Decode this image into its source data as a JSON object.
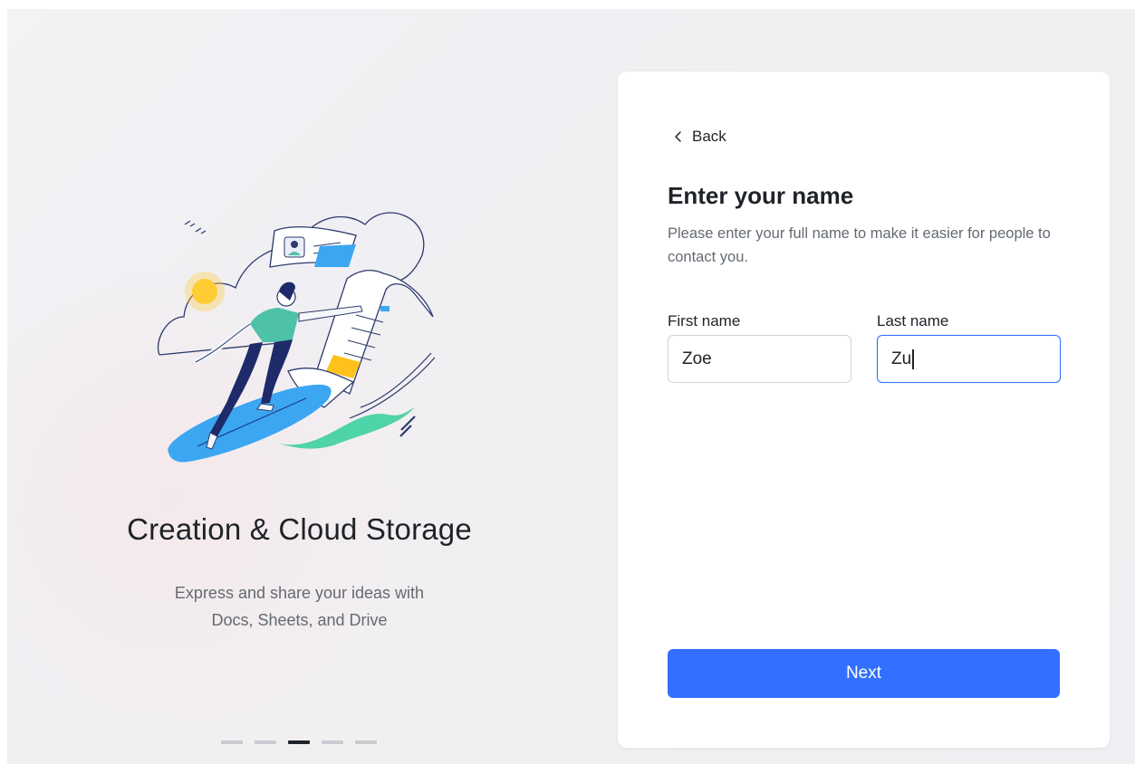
{
  "promo": {
    "title": "Creation & Cloud Storage",
    "subtitle_line1": "Express and share your ideas with",
    "subtitle_line2": "Docs, Sheets, and Drive",
    "pager": {
      "count": 5,
      "active_index": 2
    },
    "illustration": "surfer-on-document-illustration"
  },
  "form": {
    "back_label": "Back",
    "title": "Enter your name",
    "description": "Please enter your full name to make it easier for people to contact you.",
    "first_name": {
      "label": "First name",
      "value": "Zoe"
    },
    "last_name": {
      "label": "Last name",
      "value": "Zu"
    },
    "next_label": "Next"
  },
  "colors": {
    "accent": "#3370ff",
    "text_primary": "#1f2329",
    "text_secondary": "#646a73"
  }
}
